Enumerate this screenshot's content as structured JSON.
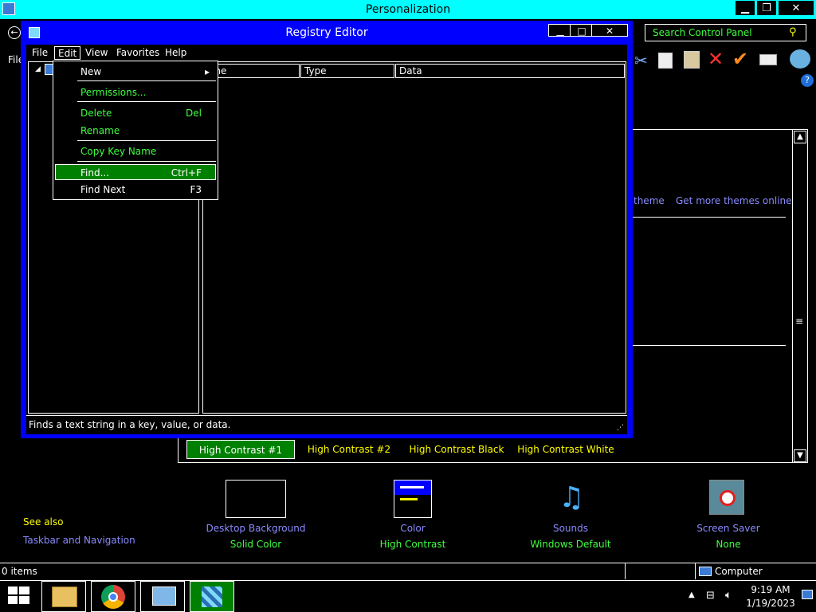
{
  "personalization": {
    "title": "Personalization",
    "menu_file": "File",
    "search_placeholder": "Search Control Panel",
    "links": {
      "theme": "theme",
      "get_more_themes": "Get more themes online"
    },
    "themes": [
      {
        "label": "High Contrast #1",
        "selected": true
      },
      {
        "label": "High Contrast #2",
        "selected": false
      },
      {
        "label": "High Contrast Black",
        "selected": false
      },
      {
        "label": "High Contrast White",
        "selected": false
      }
    ],
    "see_also": {
      "heading": "See also",
      "link": "Taskbar and Navigation"
    },
    "tiles": [
      {
        "title": "Desktop Background",
        "subtitle": "Solid Color",
        "icon": "desktop-background-icon"
      },
      {
        "title": "Color",
        "subtitle": "High Contrast",
        "icon": "color-icon"
      },
      {
        "title": "Sounds",
        "subtitle": "Windows Default",
        "icon": "sounds-icon"
      },
      {
        "title": "Screen Saver",
        "subtitle": "None",
        "icon": "screen-saver-icon"
      }
    ],
    "status": {
      "items": "0 items",
      "location": "Computer"
    }
  },
  "registry_editor": {
    "title": "Registry Editor",
    "menu": [
      "File",
      "Edit",
      "View",
      "Favorites",
      "Help"
    ],
    "columns": [
      "Name",
      "Type",
      "Data"
    ],
    "status_text": "Finds a text string in a key, value, or data.",
    "edit_menu": [
      {
        "label": "New",
        "shortcut": "",
        "submenu": true,
        "highlighted": false
      },
      {
        "label": "Permissions...",
        "shortcut": "",
        "submenu": false,
        "highlighted": false
      },
      {
        "label": "Delete",
        "shortcut": "Del",
        "submenu": false,
        "highlighted": false
      },
      {
        "label": "Rename",
        "shortcut": "",
        "submenu": false,
        "highlighted": false
      },
      {
        "label": "Copy Key Name",
        "shortcut": "",
        "submenu": false,
        "highlighted": false
      },
      {
        "label": "Find...",
        "shortcut": "Ctrl+F",
        "submenu": false,
        "highlighted": true
      },
      {
        "label": "Find Next",
        "shortcut": "F3",
        "submenu": false,
        "highlighted": false
      }
    ]
  },
  "taskbar": {
    "time": "9:19 AM",
    "date": "1/19/2023",
    "apps": [
      "start-button",
      "file-explorer",
      "chrome",
      "control-panel",
      "registry-editor"
    ]
  },
  "colors": {
    "title_cyan": "#00ffff",
    "registry_blue": "#0000ff",
    "highlight_green": "#008000",
    "text_green": "#3fff3f",
    "link_purple": "#8a8aff",
    "text_yellow": "#ffff00"
  }
}
